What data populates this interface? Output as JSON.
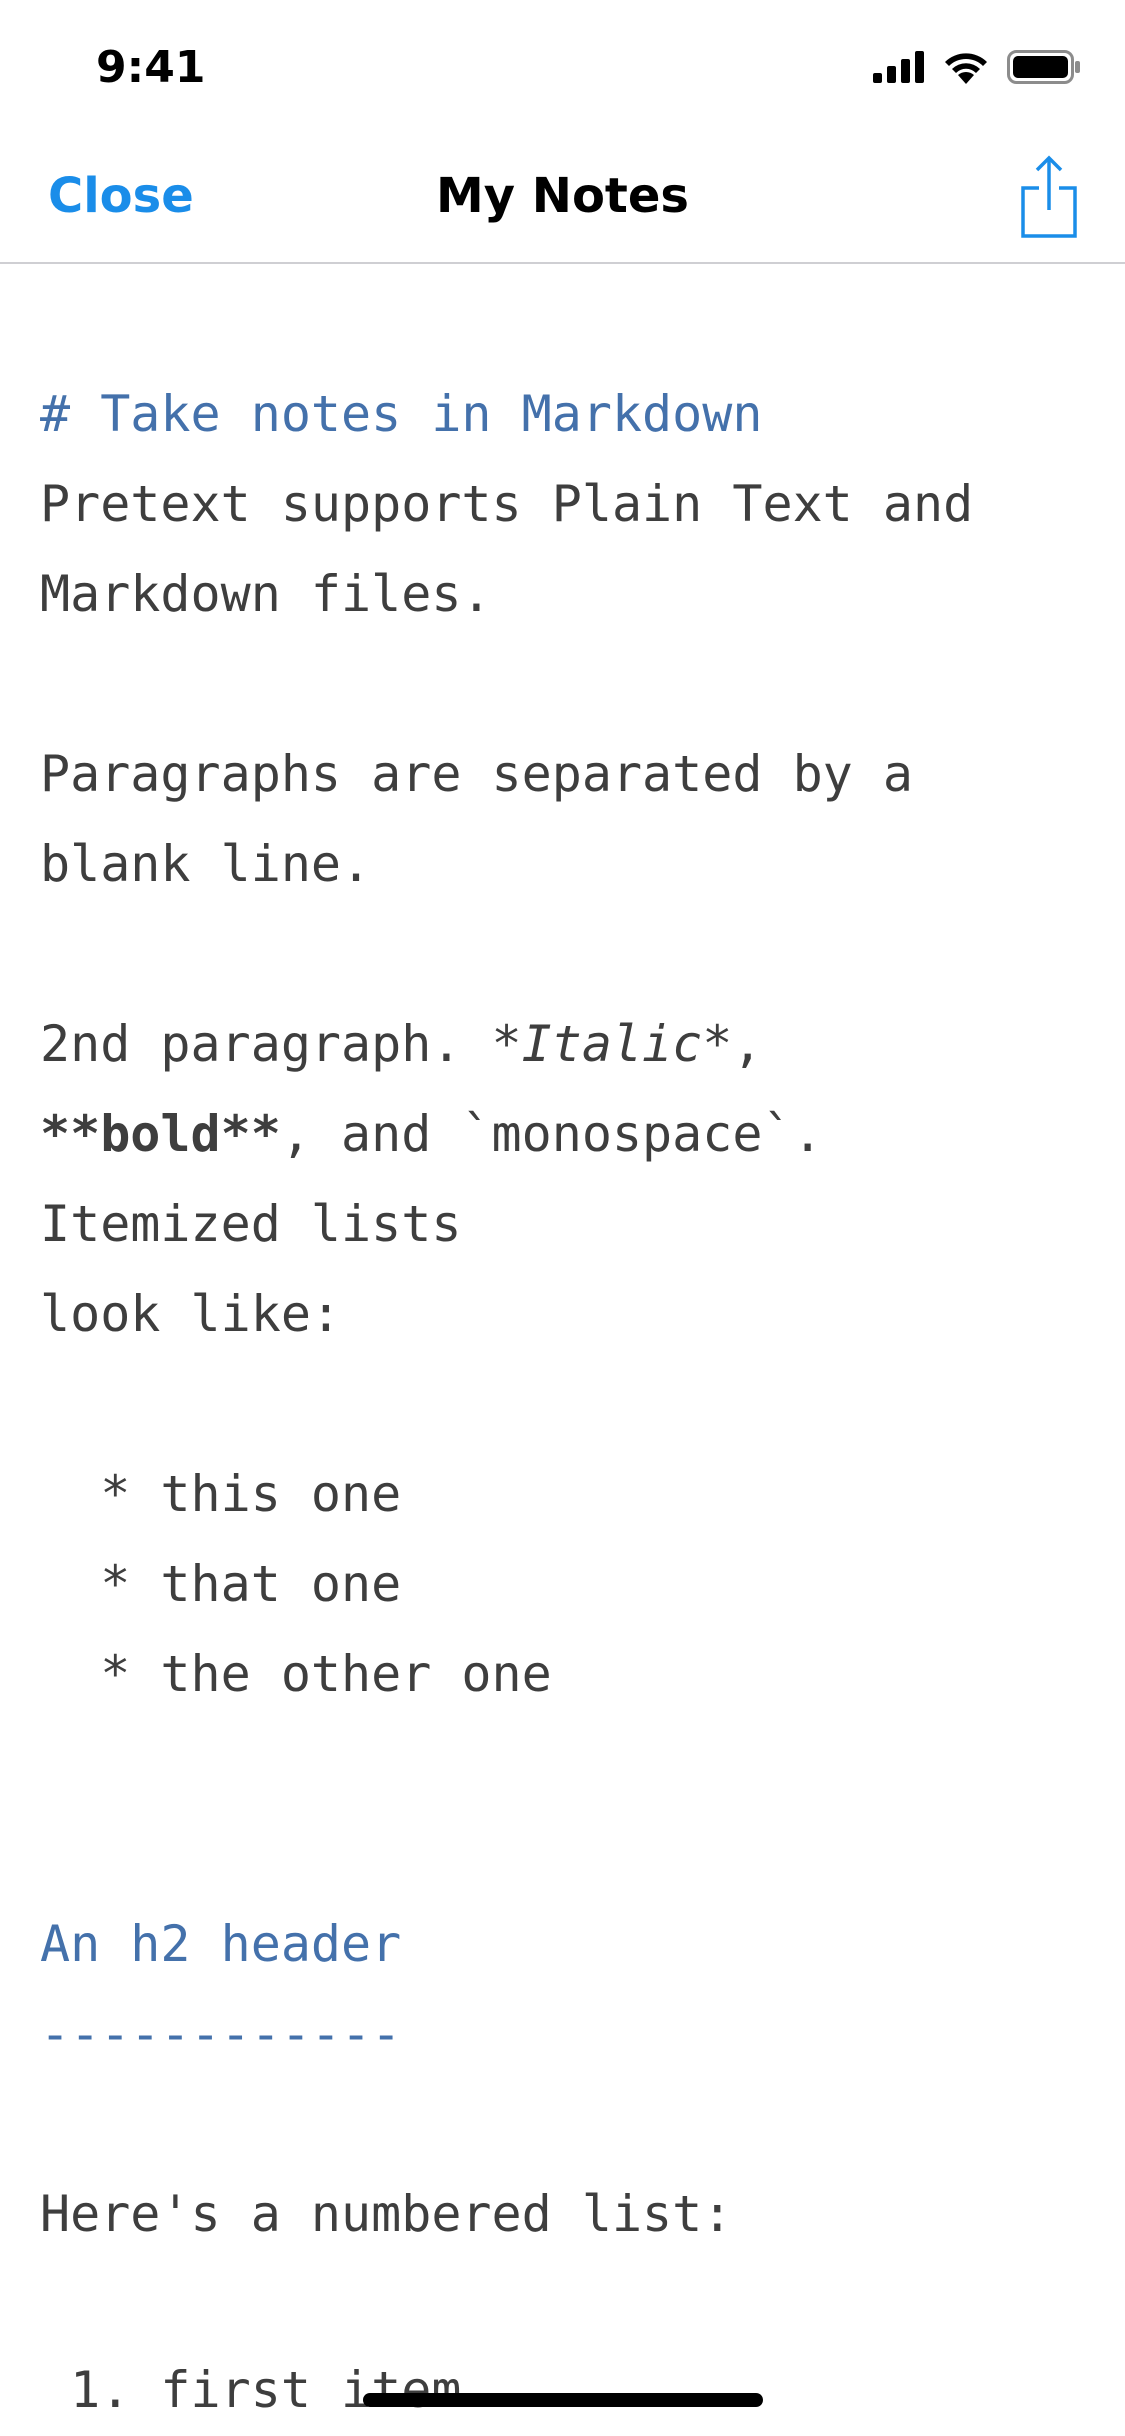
{
  "status_bar": {
    "time": "9:41",
    "icons": [
      "cellular-signal-icon",
      "wifi-icon",
      "battery-icon"
    ]
  },
  "nav_bar": {
    "close_label": "Close",
    "title": "My Notes",
    "share_icon": "share-icon"
  },
  "colors": {
    "accent": "#1a8de9",
    "markdown_header": "#4471ab",
    "body_text": "#3e3e3e",
    "separator": "#cfcfd3"
  },
  "editor": {
    "h1": "# Take notes in Markdown",
    "p1_line1": "Pretext supports Plain Text and",
    "p1_line2": "Markdown files.",
    "p2_line1": "Paragraphs are separated by a",
    "p2_line2": "blank line.",
    "p3_prefix": "2nd paragraph. ",
    "p3_italic": "*Italic*",
    "p3_comma": ",",
    "p3_bold": "**bold**",
    "p3_rest": ", and `monospace`.",
    "p3_line3": "Itemized lists",
    "p3_line4": "look like:",
    "bullet1": "  * this one",
    "bullet2": "  * that one",
    "bullet3": "  * the other one",
    "h2": "An h2 header",
    "h2_underline": "------------",
    "numbered_intro": "Here's a numbered list:",
    "num1": " 1. first item"
  }
}
